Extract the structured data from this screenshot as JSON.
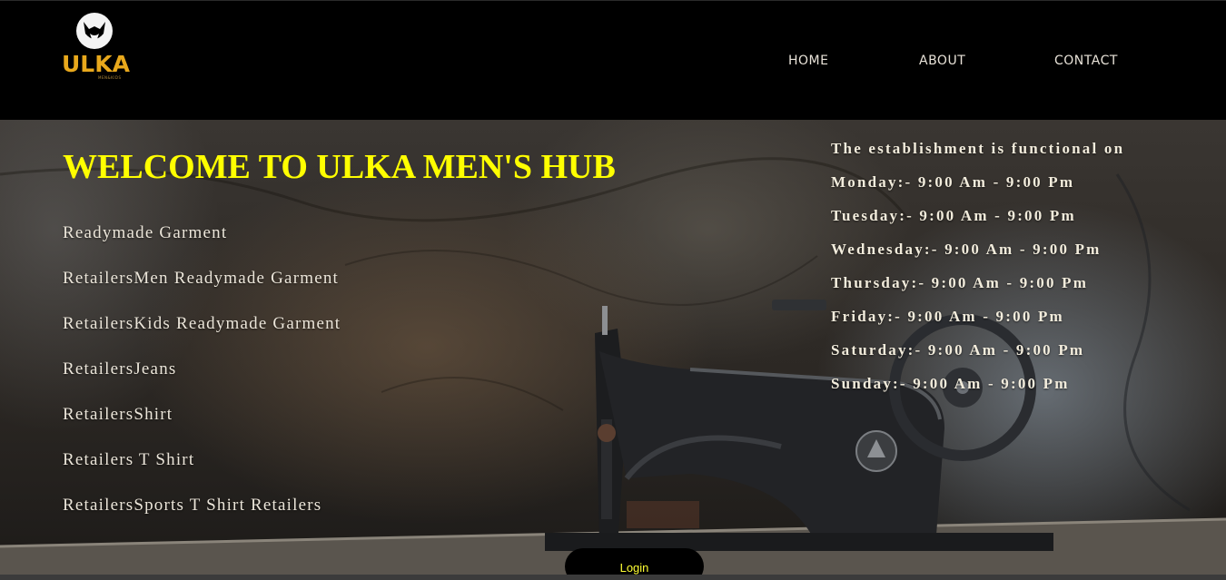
{
  "header": {
    "logo": {
      "text": "ULKA",
      "subtext": "MEN&KIDS",
      "icon": "cat-head-icon",
      "color": "#e8a81c"
    },
    "nav": [
      {
        "label": "HOME"
      },
      {
        "label": "ABOUT"
      },
      {
        "label": "CONTACT"
      }
    ]
  },
  "hero": {
    "title": "WELCOME TO ULKA MEN'S HUB",
    "title_color": "#ffff00",
    "background": "vintage-sewing-machine-photo",
    "services": [
      "Readymade Garment",
      "RetailersMen Readymade Garment",
      "RetailersKids Readymade Garment",
      "RetailersJeans",
      "RetailersShirt",
      "Retailers T Shirt",
      "RetailersSports T Shirt Retailers"
    ],
    "hours_intro": "The establishment is functional on",
    "hours": [
      "Monday:- 9:00 Am - 9:00 Pm",
      "Tuesday:- 9:00 Am - 9:00 Pm",
      "Wednesday:- 9:00 Am - 9:00 Pm",
      "Thursday:- 9:00 Am - 9:00 Pm",
      "Friday:- 9:00 Am - 9:00 Pm",
      "Saturday:- 9:00 Am - 9:00 Pm",
      "Sunday:- 9:00 Am - 9:00 Pm"
    ]
  },
  "login": {
    "label": "Login",
    "color": "#ffff33"
  }
}
